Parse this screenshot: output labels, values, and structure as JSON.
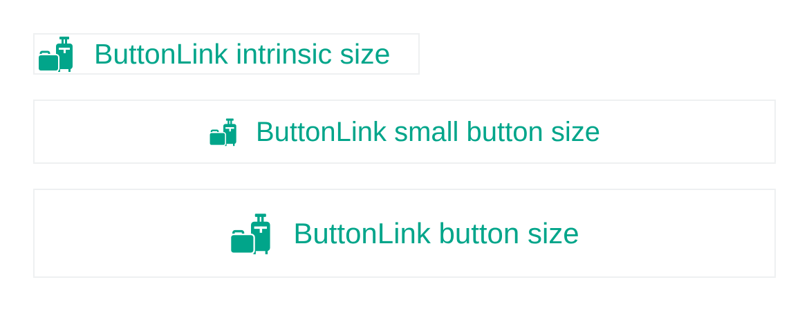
{
  "colors": {
    "accent": "#01a58a",
    "border": "#eef0f1",
    "background": "#ffffff"
  },
  "buttons": [
    {
      "label": "ButtonLink intrinsic size",
      "icon": "luggage-icon"
    },
    {
      "label": "ButtonLink small button size",
      "icon": "luggage-icon"
    },
    {
      "label": "ButtonLink button size",
      "icon": "luggage-icon"
    }
  ]
}
